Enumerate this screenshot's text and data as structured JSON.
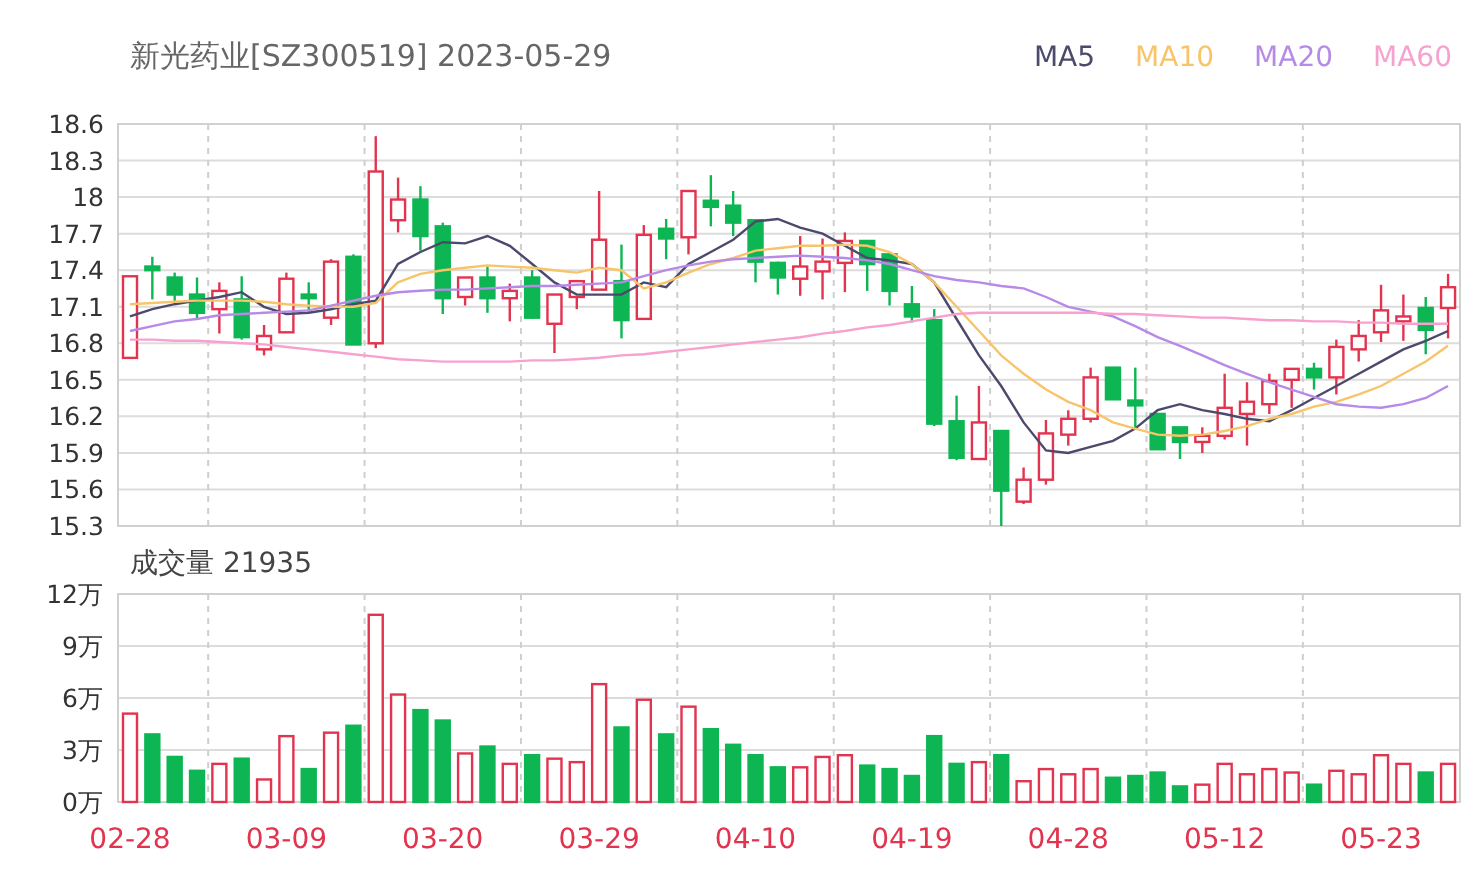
{
  "header": {
    "title": "新光药业[SZ300519] 2023-05-29"
  },
  "price_chart": {
    "chart_data": {
      "type": "candlestick",
      "grid": true,
      "ylim": [
        15.3,
        18.6
      ],
      "ohlc": [
        [
          16.68,
          17.35,
          16.68,
          17.35
        ],
        [
          17.43,
          17.51,
          17.16,
          17.4
        ],
        [
          17.34,
          17.38,
          17.13,
          17.2
        ],
        [
          17.2,
          17.34,
          17.0,
          17.05
        ],
        [
          17.08,
          17.3,
          16.88,
          17.23
        ],
        [
          17.16,
          17.35,
          16.83,
          16.85
        ],
        [
          16.75,
          16.95,
          16.7,
          16.86
        ],
        [
          16.89,
          17.38,
          16.89,
          17.33
        ],
        [
          17.2,
          17.3,
          17.05,
          17.17
        ],
        [
          17.01,
          17.49,
          16.95,
          17.47
        ],
        [
          17.51,
          17.53,
          16.79,
          16.79
        ],
        [
          16.8,
          18.5,
          16.76,
          18.21
        ],
        [
          17.81,
          18.16,
          17.71,
          17.98
        ],
        [
          17.98,
          18.09,
          17.56,
          17.68
        ],
        [
          17.76,
          17.79,
          17.04,
          17.17
        ],
        [
          17.18,
          17.34,
          17.11,
          17.34
        ],
        [
          17.34,
          17.43,
          17.05,
          17.17
        ],
        [
          17.17,
          17.29,
          16.98,
          17.23
        ],
        [
          17.34,
          17.4,
          17.0,
          17.01
        ],
        [
          16.96,
          17.2,
          16.72,
          17.2
        ],
        [
          17.18,
          17.31,
          17.08,
          17.31
        ],
        [
          17.24,
          18.05,
          17.24,
          17.65
        ],
        [
          17.31,
          17.61,
          16.84,
          16.99
        ],
        [
          17.0,
          17.77,
          17.0,
          17.69
        ],
        [
          17.74,
          17.82,
          17.49,
          17.66
        ],
        [
          17.67,
          18.05,
          17.53,
          18.05
        ],
        [
          17.97,
          18.18,
          17.76,
          17.92
        ],
        [
          17.93,
          18.05,
          17.68,
          17.79
        ],
        [
          17.81,
          17.81,
          17.3,
          17.47
        ],
        [
          17.46,
          17.47,
          17.2,
          17.34
        ],
        [
          17.33,
          17.68,
          17.19,
          17.43
        ],
        [
          17.39,
          17.66,
          17.16,
          17.47
        ],
        [
          17.46,
          17.71,
          17.22,
          17.64
        ],
        [
          17.64,
          17.64,
          17.23,
          17.45
        ],
        [
          17.53,
          17.53,
          17.11,
          17.23
        ],
        [
          17.12,
          17.27,
          16.97,
          17.02
        ],
        [
          16.99,
          17.08,
          16.12,
          16.14
        ],
        [
          16.16,
          16.37,
          15.84,
          15.86
        ],
        [
          15.85,
          16.45,
          15.85,
          16.15
        ],
        [
          16.08,
          16.08,
          15.3,
          15.59
        ],
        [
          15.5,
          15.78,
          15.48,
          15.68
        ],
        [
          15.68,
          16.17,
          15.64,
          16.06
        ],
        [
          16.05,
          16.25,
          15.96,
          16.18
        ],
        [
          16.18,
          16.6,
          16.15,
          16.52
        ],
        [
          16.6,
          16.6,
          16.34,
          16.34
        ],
        [
          16.33,
          16.6,
          16.09,
          16.29
        ],
        [
          16.22,
          16.22,
          15.93,
          15.93
        ],
        [
          16.11,
          16.11,
          15.85,
          15.99
        ],
        [
          15.99,
          16.11,
          15.9,
          16.04
        ],
        [
          16.04,
          16.55,
          16.01,
          16.27
        ],
        [
          16.22,
          16.48,
          15.96,
          16.32
        ],
        [
          16.3,
          16.55,
          16.22,
          16.49
        ],
        [
          16.5,
          16.59,
          16.27,
          16.59
        ],
        [
          16.59,
          16.64,
          16.42,
          16.52
        ],
        [
          16.52,
          16.83,
          16.38,
          16.77
        ],
        [
          16.75,
          16.99,
          16.65,
          16.86
        ],
        [
          16.89,
          17.28,
          16.81,
          17.07
        ],
        [
          16.98,
          17.2,
          16.82,
          17.02
        ],
        [
          17.09,
          17.18,
          16.71,
          16.91
        ],
        [
          17.09,
          17.37,
          16.84,
          17.26
        ]
      ]
    }
  },
  "moving_averages": {
    "chart_data": {
      "type": "line",
      "ylim": [
        15.3,
        18.6
      ],
      "yticks": [
        {
          "value": 18.6,
          "label": "18.6"
        },
        {
          "value": 18.3,
          "label": "18.3"
        },
        {
          "value": 18,
          "label": "18"
        },
        {
          "value": 17.7,
          "label": "17.7"
        },
        {
          "value": 17.4,
          "label": "17.4"
        },
        {
          "value": 17.1,
          "label": "17.1"
        },
        {
          "value": 16.8,
          "label": "16.8"
        },
        {
          "value": 16.5,
          "label": "16.5"
        },
        {
          "value": 16.2,
          "label": "16.2"
        },
        {
          "value": 15.9,
          "label": "15.9"
        },
        {
          "value": 15.6,
          "label": "15.6"
        },
        {
          "value": 15.3,
          "label": "15.3"
        }
      ],
      "series": [
        {
          "name": "MA5",
          "color": "#4b4a6d",
          "values": [
            17.02,
            17.08,
            17.12,
            17.15,
            17.18,
            17.22,
            17.1,
            17.04,
            17.05,
            17.08,
            17.12,
            17.15,
            17.45,
            17.55,
            17.63,
            17.62,
            17.68,
            17.6,
            17.45,
            17.3,
            17.2,
            17.2,
            17.2,
            17.3,
            17.26,
            17.45,
            17.55,
            17.65,
            17.8,
            17.82,
            17.75,
            17.7,
            17.6,
            17.5,
            17.48,
            17.45,
            17.3,
            17.0,
            16.7,
            16.45,
            16.15,
            15.92,
            15.9,
            15.95,
            16.0,
            16.1,
            16.25,
            16.3,
            16.25,
            16.22,
            16.18,
            16.16,
            16.25,
            16.35,
            16.45,
            16.55,
            16.65,
            16.75,
            16.82,
            16.9
          ]
        },
        {
          "name": "MA10",
          "color": "#f8c46a",
          "values": [
            17.12,
            17.13,
            17.14,
            17.15,
            17.15,
            17.15,
            17.14,
            17.12,
            17.11,
            17.1,
            17.1,
            17.13,
            17.3,
            17.37,
            17.4,
            17.42,
            17.44,
            17.43,
            17.42,
            17.4,
            17.38,
            17.42,
            17.4,
            17.25,
            17.3,
            17.38,
            17.45,
            17.5,
            17.56,
            17.58,
            17.6,
            17.6,
            17.61,
            17.6,
            17.55,
            17.45,
            17.3,
            17.1,
            16.9,
            16.7,
            16.55,
            16.42,
            16.32,
            16.25,
            16.15,
            16.1,
            16.05,
            16.04,
            16.05,
            16.08,
            16.12,
            16.18,
            16.22,
            16.28,
            16.32,
            16.38,
            16.45,
            16.55,
            16.65,
            16.78
          ]
        },
        {
          "name": "MA20",
          "color": "#b78ae8",
          "values": [
            16.9,
            16.94,
            16.98,
            17.0,
            17.03,
            17.04,
            17.05,
            17.06,
            17.07,
            17.11,
            17.15,
            17.19,
            17.22,
            17.23,
            17.24,
            17.24,
            17.25,
            17.26,
            17.27,
            17.27,
            17.28,
            17.29,
            17.3,
            17.35,
            17.4,
            17.44,
            17.47,
            17.49,
            17.5,
            17.51,
            17.52,
            17.51,
            17.5,
            17.48,
            17.45,
            17.4,
            17.35,
            17.32,
            17.3,
            17.27,
            17.25,
            17.18,
            17.1,
            17.06,
            17.02,
            16.94,
            16.85,
            16.78,
            16.7,
            16.62,
            16.55,
            16.48,
            16.42,
            16.36,
            16.3,
            16.28,
            16.27,
            16.3,
            16.35,
            16.45
          ]
        },
        {
          "name": "MA60",
          "color": "#f7a1cf",
          "values": [
            16.83,
            16.83,
            16.82,
            16.82,
            16.81,
            16.8,
            16.79,
            16.77,
            16.75,
            16.73,
            16.71,
            16.69,
            16.67,
            16.66,
            16.65,
            16.65,
            16.65,
            16.65,
            16.66,
            16.66,
            16.67,
            16.68,
            16.7,
            16.71,
            16.73,
            16.75,
            16.77,
            16.79,
            16.81,
            16.83,
            16.85,
            16.88,
            16.9,
            16.93,
            16.95,
            16.98,
            17.01,
            17.04,
            17.05,
            17.05,
            17.05,
            17.05,
            17.05,
            17.05,
            17.04,
            17.04,
            17.03,
            17.02,
            17.01,
            17.01,
            17.0,
            16.99,
            16.99,
            16.98,
            16.98,
            16.97,
            16.97,
            16.96,
            16.96,
            16.96
          ]
        }
      ]
    }
  },
  "volume_chart": {
    "title": "成交量 21935",
    "chart_data": {
      "type": "bar",
      "grid": true,
      "ylim": [
        0,
        12
      ],
      "yticks": [
        {
          "value": 12,
          "label": "12万"
        },
        {
          "value": 9,
          "label": "9万"
        },
        {
          "value": 6,
          "label": "6万"
        },
        {
          "value": 3,
          "label": "3万"
        },
        {
          "value": 0,
          "label": "0万"
        }
      ],
      "categories": [
        "02-28",
        null,
        null,
        null,
        null,
        null,
        null,
        "03-09",
        null,
        null,
        null,
        null,
        null,
        null,
        "03-20",
        null,
        null,
        null,
        null,
        null,
        null,
        "03-29",
        null,
        null,
        null,
        null,
        null,
        null,
        "04-10",
        null,
        null,
        null,
        null,
        null,
        null,
        "04-19",
        null,
        null,
        null,
        null,
        null,
        null,
        "04-28",
        null,
        null,
        null,
        null,
        null,
        null,
        "05-12",
        null,
        null,
        null,
        null,
        null,
        null,
        "05-23",
        null,
        null,
        null
      ],
      "values": [
        5.1,
        3.9,
        2.6,
        1.8,
        2.2,
        2.5,
        1.3,
        3.8,
        1.9,
        4.0,
        4.4,
        10.8,
        6.2,
        5.3,
        4.7,
        2.8,
        3.2,
        2.2,
        2.7,
        2.5,
        2.3,
        6.8,
        4.3,
        5.9,
        3.9,
        5.5,
        4.2,
        3.3,
        2.7,
        2.0,
        2.0,
        2.6,
        2.7,
        2.1,
        1.9,
        1.5,
        3.8,
        2.2,
        2.3,
        2.7,
        1.2,
        1.9,
        1.6,
        1.9,
        1.4,
        1.5,
        1.7,
        0.9,
        1.0,
        2.2,
        1.6,
        1.9,
        1.7,
        1.0,
        1.8,
        1.6,
        2.7,
        2.2,
        1.7,
        2.2
      ]
    }
  }
}
